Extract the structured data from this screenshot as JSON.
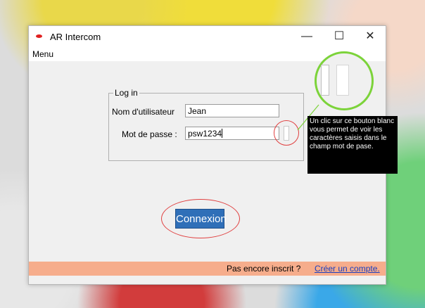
{
  "window": {
    "title": "AR Intercom",
    "controls": {
      "minimize": "—",
      "maximize": "☐",
      "close": "✕"
    }
  },
  "menubar": {
    "menu_label": "Menu"
  },
  "login": {
    "group_label": "Log in",
    "username_label": "Nom d'utilisateur",
    "username_value": "Jean",
    "password_label": "Mot de passe :",
    "password_value": "psw1234"
  },
  "tooltip": {
    "text": "Un clic sur ce bouton blanc vous permet de voir les caractères saisis dans le champ mot de pase."
  },
  "actions": {
    "connect_label": "Connexion"
  },
  "footer": {
    "prompt": "Pas encore inscrit ?",
    "link": "Créer un compte."
  },
  "colors": {
    "annotation_ring": "#e04040",
    "zoom_ring": "#7cd33a",
    "connect_button": "#2f6fb8",
    "footer_bg": "#f6ad8c",
    "link": "#1a3fbf"
  }
}
